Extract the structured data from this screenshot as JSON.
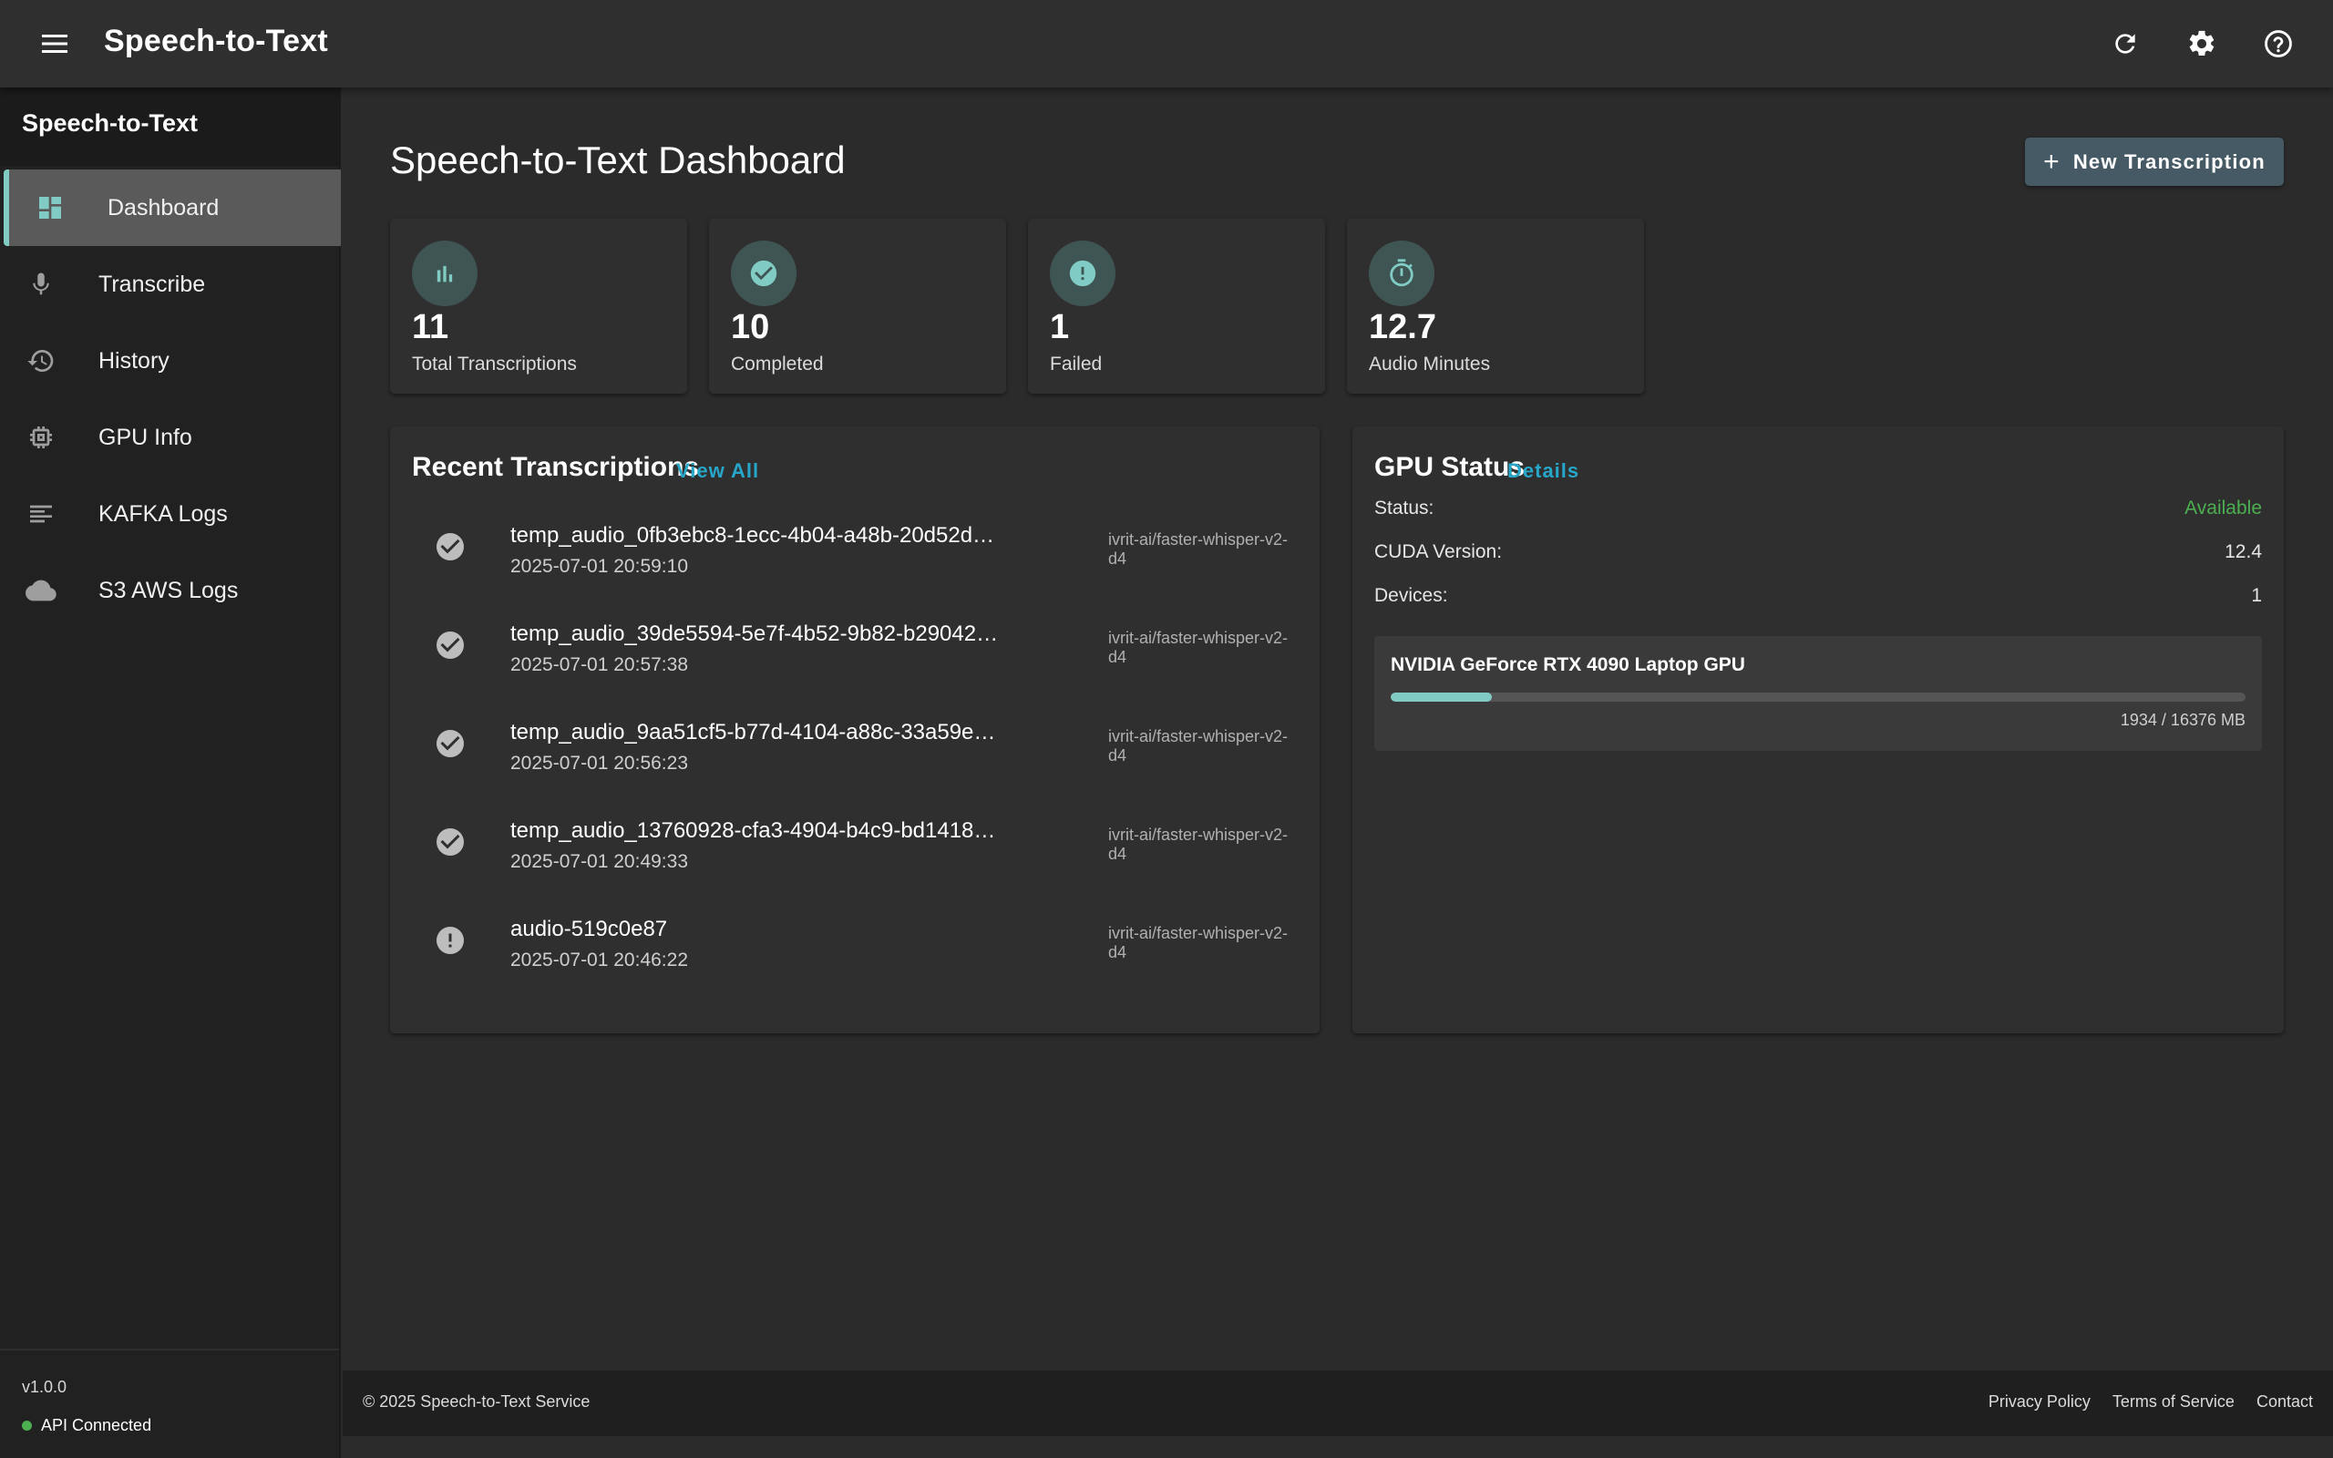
{
  "appbar": {
    "title": "Speech-to-Text",
    "icons": [
      "menu-icon",
      "refresh-icon",
      "settings-icon",
      "help-icon"
    ]
  },
  "sidebar": {
    "header": "Speech-to-Text",
    "items": [
      {
        "label": "Dashboard",
        "icon": "dashboard-icon",
        "active": true
      },
      {
        "label": "Transcribe",
        "icon": "mic-icon"
      },
      {
        "label": "History",
        "icon": "history-icon"
      },
      {
        "label": "GPU Info",
        "icon": "chip-icon"
      },
      {
        "label": "KAFKA Logs",
        "icon": "log-lines-icon"
      },
      {
        "label": "S3 AWS Logs",
        "icon": "cloud-icon"
      }
    ],
    "version": "v1.0.0",
    "api_status": "API Connected"
  },
  "main": {
    "title": "Speech-to-Text Dashboard",
    "new_button": "New Transcription",
    "stats": [
      {
        "value": "11",
        "label": "Total Transcriptions",
        "icon": "bar-chart-icon"
      },
      {
        "value": "10",
        "label": "Completed",
        "icon": "check-circle-icon"
      },
      {
        "value": "1",
        "label": "Failed",
        "icon": "error-icon"
      },
      {
        "value": "12.7",
        "label": "Audio Minutes",
        "icon": "timer-icon"
      }
    ],
    "recent": {
      "title": "Recent Transcriptions",
      "link": "View All",
      "items": [
        {
          "name": "temp_audio_0fb3ebc8-1ecc-4b04-a48b-20d52d…",
          "date": "2025-07-01 20:59:10",
          "model": "ivrit-ai/faster-whisper-v2-d4",
          "status": "completed"
        },
        {
          "name": "temp_audio_39de5594-5e7f-4b52-9b82-b29042…",
          "date": "2025-07-01 20:57:38",
          "model": "ivrit-ai/faster-whisper-v2-d4",
          "status": "completed"
        },
        {
          "name": "temp_audio_9aa51cf5-b77d-4104-a88c-33a59e…",
          "date": "2025-07-01 20:56:23",
          "model": "ivrit-ai/faster-whisper-v2-d4",
          "status": "completed"
        },
        {
          "name": "temp_audio_13760928-cfa3-4904-b4c9-bd1418…",
          "date": "2025-07-01 20:49:33",
          "model": "ivrit-ai/faster-whisper-v2-d4",
          "status": "completed"
        },
        {
          "name": "audio-519c0e87",
          "date": "2025-07-01 20:46:22",
          "model": "ivrit-ai/faster-whisper-v2-d4",
          "status": "failed"
        }
      ]
    },
    "gpu": {
      "title": "GPU Status",
      "link": "Details",
      "status_label": "Status:",
      "status_value": "Available",
      "cuda_label": "CUDA Version:",
      "cuda_value": "12.4",
      "devices_label": "Devices:",
      "devices_value": "1",
      "device_name": "NVIDIA GeForce RTX 4090 Laptop GPU",
      "memory_text": "1934 / 16376 MB",
      "memory_fraction": 0.118
    }
  },
  "footer": {
    "copyright": "© 2025 Speech-to-Text Service",
    "links": [
      "Privacy Policy",
      "Terms of Service",
      "Contact"
    ]
  },
  "colors": {
    "accent": "#80cbc4",
    "link": "#26a6c8",
    "success": "#4caf50",
    "button": "#455a64"
  }
}
